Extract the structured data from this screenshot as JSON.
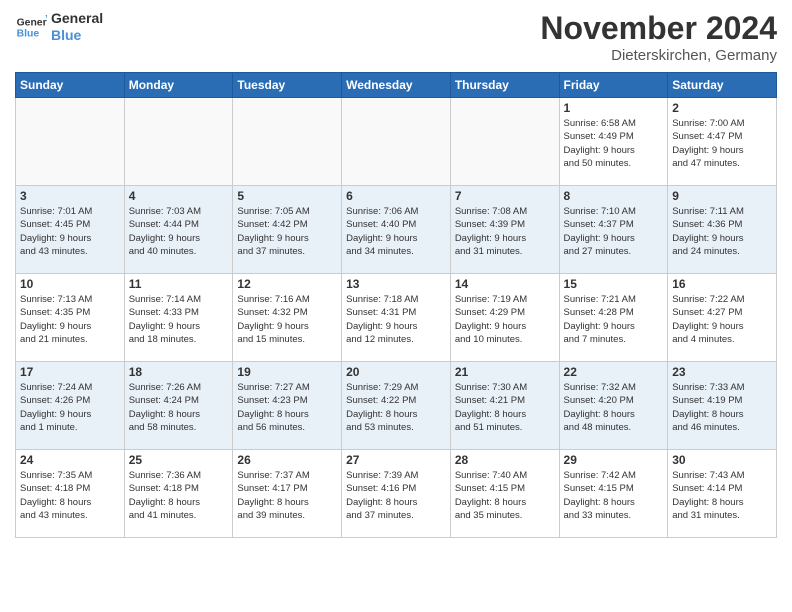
{
  "header": {
    "logo_line1": "General",
    "logo_line2": "Blue",
    "month": "November 2024",
    "location": "Dieterskirchen, Germany"
  },
  "weekdays": [
    "Sunday",
    "Monday",
    "Tuesday",
    "Wednesday",
    "Thursday",
    "Friday",
    "Saturday"
  ],
  "weeks": [
    [
      {
        "day": "",
        "info": ""
      },
      {
        "day": "",
        "info": ""
      },
      {
        "day": "",
        "info": ""
      },
      {
        "day": "",
        "info": ""
      },
      {
        "day": "",
        "info": ""
      },
      {
        "day": "1",
        "info": "Sunrise: 6:58 AM\nSunset: 4:49 PM\nDaylight: 9 hours\nand 50 minutes."
      },
      {
        "day": "2",
        "info": "Sunrise: 7:00 AM\nSunset: 4:47 PM\nDaylight: 9 hours\nand 47 minutes."
      }
    ],
    [
      {
        "day": "3",
        "info": "Sunrise: 7:01 AM\nSunset: 4:45 PM\nDaylight: 9 hours\nand 43 minutes."
      },
      {
        "day": "4",
        "info": "Sunrise: 7:03 AM\nSunset: 4:44 PM\nDaylight: 9 hours\nand 40 minutes."
      },
      {
        "day": "5",
        "info": "Sunrise: 7:05 AM\nSunset: 4:42 PM\nDaylight: 9 hours\nand 37 minutes."
      },
      {
        "day": "6",
        "info": "Sunrise: 7:06 AM\nSunset: 4:40 PM\nDaylight: 9 hours\nand 34 minutes."
      },
      {
        "day": "7",
        "info": "Sunrise: 7:08 AM\nSunset: 4:39 PM\nDaylight: 9 hours\nand 31 minutes."
      },
      {
        "day": "8",
        "info": "Sunrise: 7:10 AM\nSunset: 4:37 PM\nDaylight: 9 hours\nand 27 minutes."
      },
      {
        "day": "9",
        "info": "Sunrise: 7:11 AM\nSunset: 4:36 PM\nDaylight: 9 hours\nand 24 minutes."
      }
    ],
    [
      {
        "day": "10",
        "info": "Sunrise: 7:13 AM\nSunset: 4:35 PM\nDaylight: 9 hours\nand 21 minutes."
      },
      {
        "day": "11",
        "info": "Sunrise: 7:14 AM\nSunset: 4:33 PM\nDaylight: 9 hours\nand 18 minutes."
      },
      {
        "day": "12",
        "info": "Sunrise: 7:16 AM\nSunset: 4:32 PM\nDaylight: 9 hours\nand 15 minutes."
      },
      {
        "day": "13",
        "info": "Sunrise: 7:18 AM\nSunset: 4:31 PM\nDaylight: 9 hours\nand 12 minutes."
      },
      {
        "day": "14",
        "info": "Sunrise: 7:19 AM\nSunset: 4:29 PM\nDaylight: 9 hours\nand 10 minutes."
      },
      {
        "day": "15",
        "info": "Sunrise: 7:21 AM\nSunset: 4:28 PM\nDaylight: 9 hours\nand 7 minutes."
      },
      {
        "day": "16",
        "info": "Sunrise: 7:22 AM\nSunset: 4:27 PM\nDaylight: 9 hours\nand 4 minutes."
      }
    ],
    [
      {
        "day": "17",
        "info": "Sunrise: 7:24 AM\nSunset: 4:26 PM\nDaylight: 9 hours\nand 1 minute."
      },
      {
        "day": "18",
        "info": "Sunrise: 7:26 AM\nSunset: 4:24 PM\nDaylight: 8 hours\nand 58 minutes."
      },
      {
        "day": "19",
        "info": "Sunrise: 7:27 AM\nSunset: 4:23 PM\nDaylight: 8 hours\nand 56 minutes."
      },
      {
        "day": "20",
        "info": "Sunrise: 7:29 AM\nSunset: 4:22 PM\nDaylight: 8 hours\nand 53 minutes."
      },
      {
        "day": "21",
        "info": "Sunrise: 7:30 AM\nSunset: 4:21 PM\nDaylight: 8 hours\nand 51 minutes."
      },
      {
        "day": "22",
        "info": "Sunrise: 7:32 AM\nSunset: 4:20 PM\nDaylight: 8 hours\nand 48 minutes."
      },
      {
        "day": "23",
        "info": "Sunrise: 7:33 AM\nSunset: 4:19 PM\nDaylight: 8 hours\nand 46 minutes."
      }
    ],
    [
      {
        "day": "24",
        "info": "Sunrise: 7:35 AM\nSunset: 4:18 PM\nDaylight: 8 hours\nand 43 minutes."
      },
      {
        "day": "25",
        "info": "Sunrise: 7:36 AM\nSunset: 4:18 PM\nDaylight: 8 hours\nand 41 minutes."
      },
      {
        "day": "26",
        "info": "Sunrise: 7:37 AM\nSunset: 4:17 PM\nDaylight: 8 hours\nand 39 minutes."
      },
      {
        "day": "27",
        "info": "Sunrise: 7:39 AM\nSunset: 4:16 PM\nDaylight: 8 hours\nand 37 minutes."
      },
      {
        "day": "28",
        "info": "Sunrise: 7:40 AM\nSunset: 4:15 PM\nDaylight: 8 hours\nand 35 minutes."
      },
      {
        "day": "29",
        "info": "Sunrise: 7:42 AM\nSunset: 4:15 PM\nDaylight: 8 hours\nand 33 minutes."
      },
      {
        "day": "30",
        "info": "Sunrise: 7:43 AM\nSunset: 4:14 PM\nDaylight: 8 hours\nand 31 minutes."
      }
    ]
  ]
}
